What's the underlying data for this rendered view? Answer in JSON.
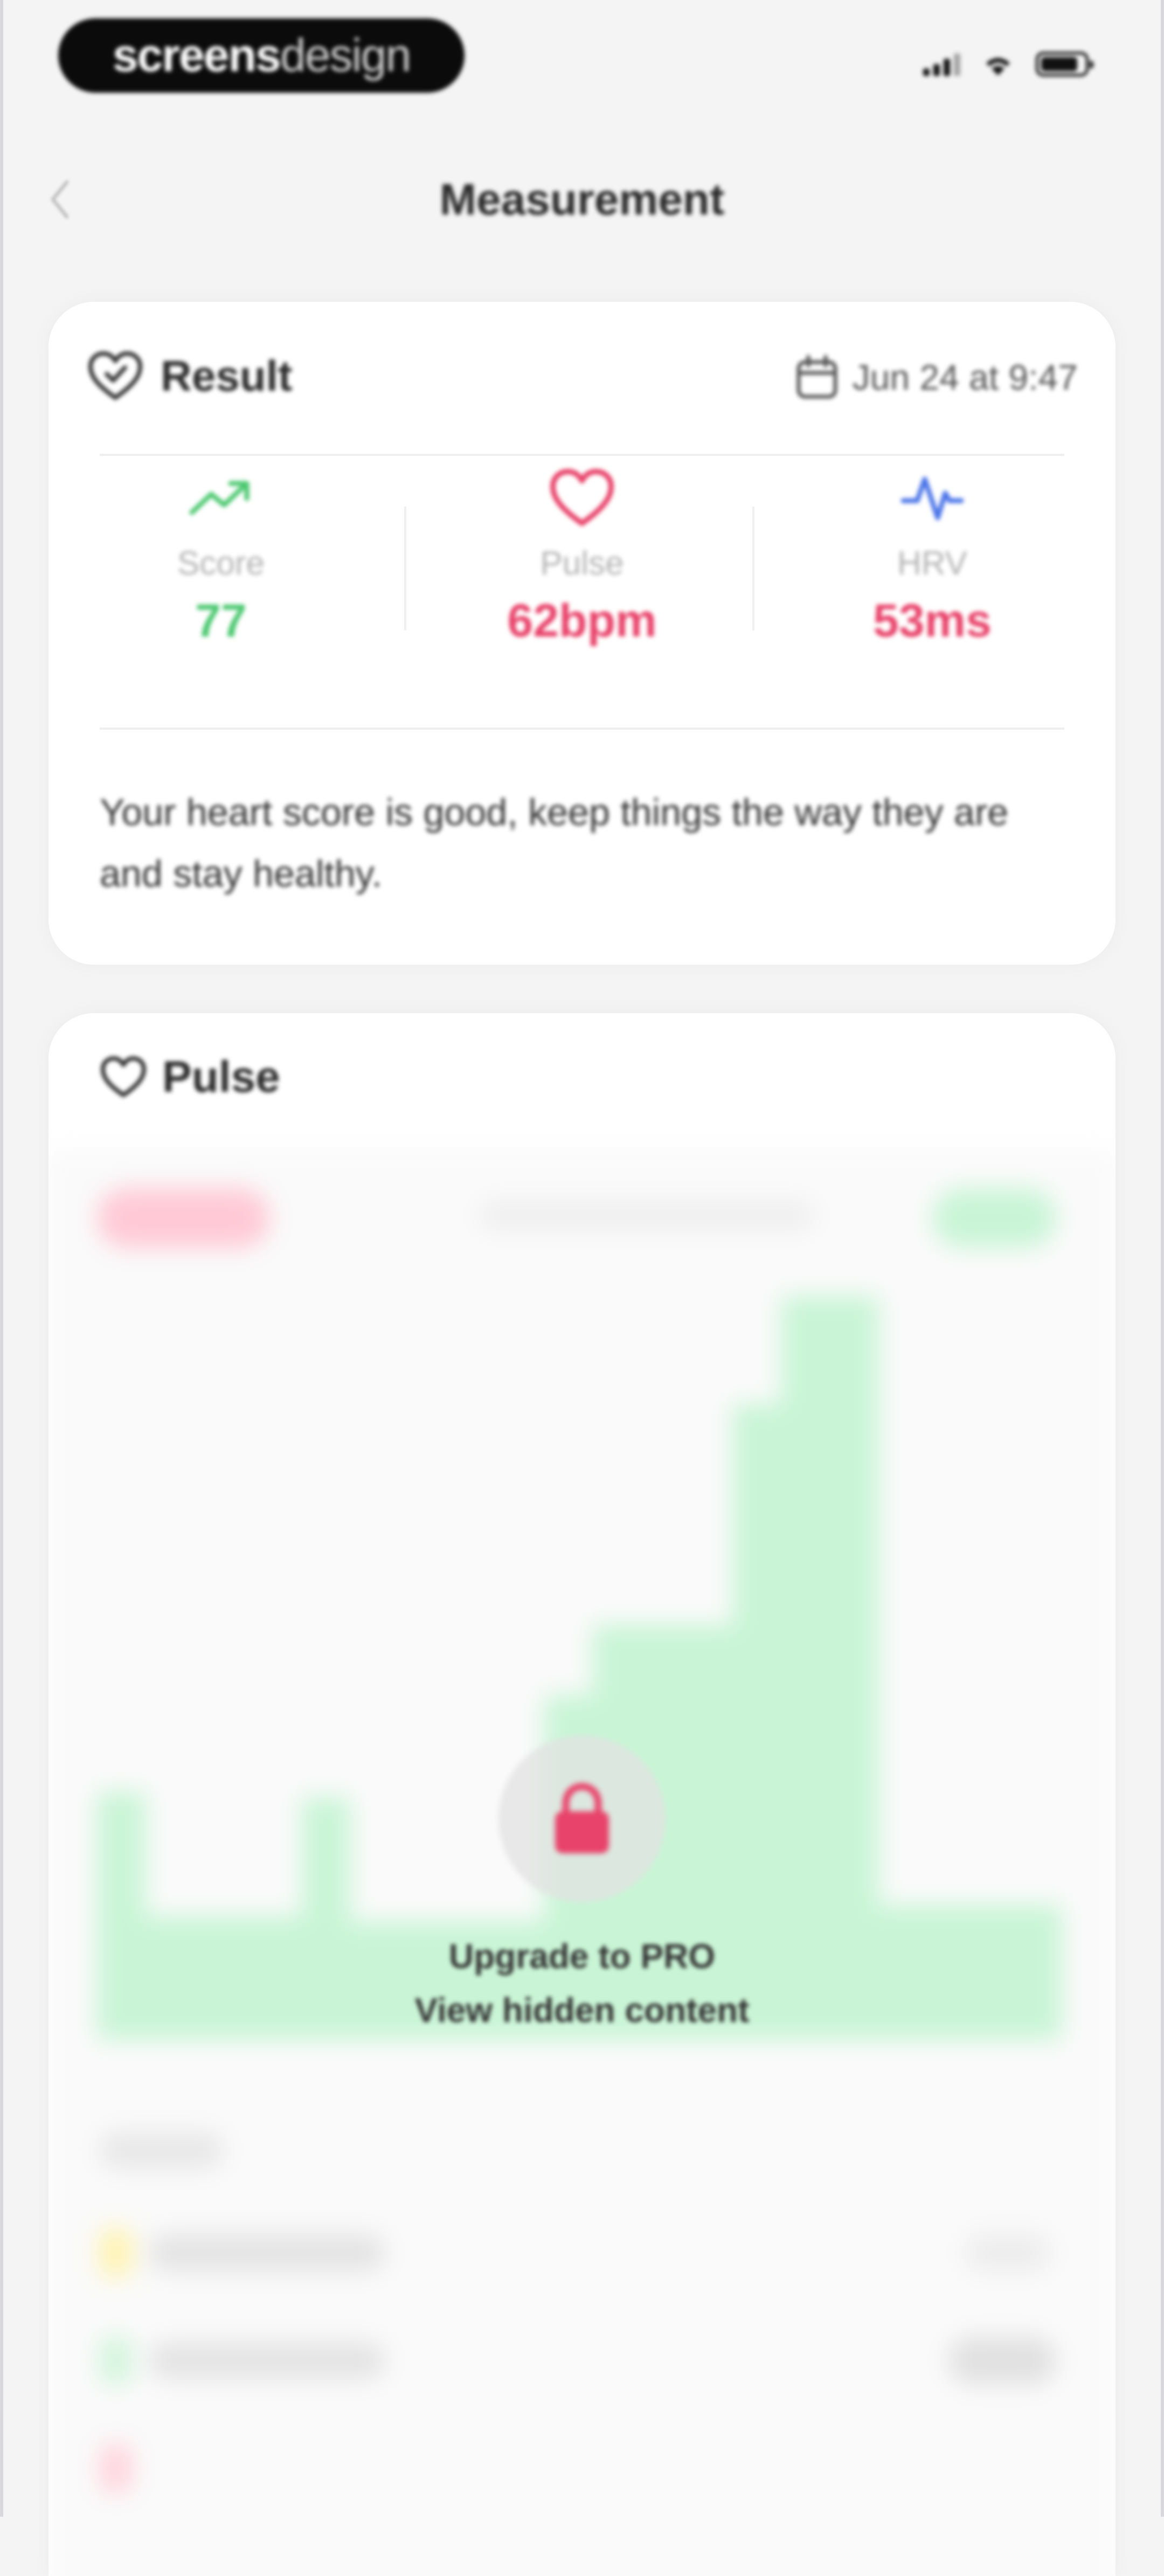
{
  "status_bar": {
    "brand_bold": "screens",
    "brand_light": "design"
  },
  "nav": {
    "title": "Measurement",
    "back_icon": "chevron-left-icon"
  },
  "result_card": {
    "title": "Result",
    "title_icon": "heart-check-icon",
    "date_icon": "calendar-icon",
    "date": "Jun 24 at 9:47",
    "metrics": [
      {
        "label": "Score",
        "value": "77",
        "icon": "trend-up-icon",
        "color": "#4cc870"
      },
      {
        "label": "Pulse",
        "value": "62bpm",
        "icon": "heart-icon",
        "color": "#e8436a"
      },
      {
        "label": "HRV",
        "value": "53ms",
        "icon": "pulse-wave-icon",
        "color": "#e8436a",
        "icon_color": "#4a74e8"
      }
    ],
    "summary": "Your heart score is good, keep things the way they are and stay healthy."
  },
  "pulse_card": {
    "title": "Pulse",
    "title_icon": "heart-icon",
    "locked": {
      "icon": "lock-icon",
      "line1": "Upgrade to PRO",
      "line2": "View hidden content"
    }
  },
  "colors": {
    "background": "#f4f4f5",
    "card": "#ffffff",
    "green": "#4cc870",
    "red": "#e8436a",
    "blue": "#4a74e8",
    "chart_fill": "#c9f5d6"
  }
}
